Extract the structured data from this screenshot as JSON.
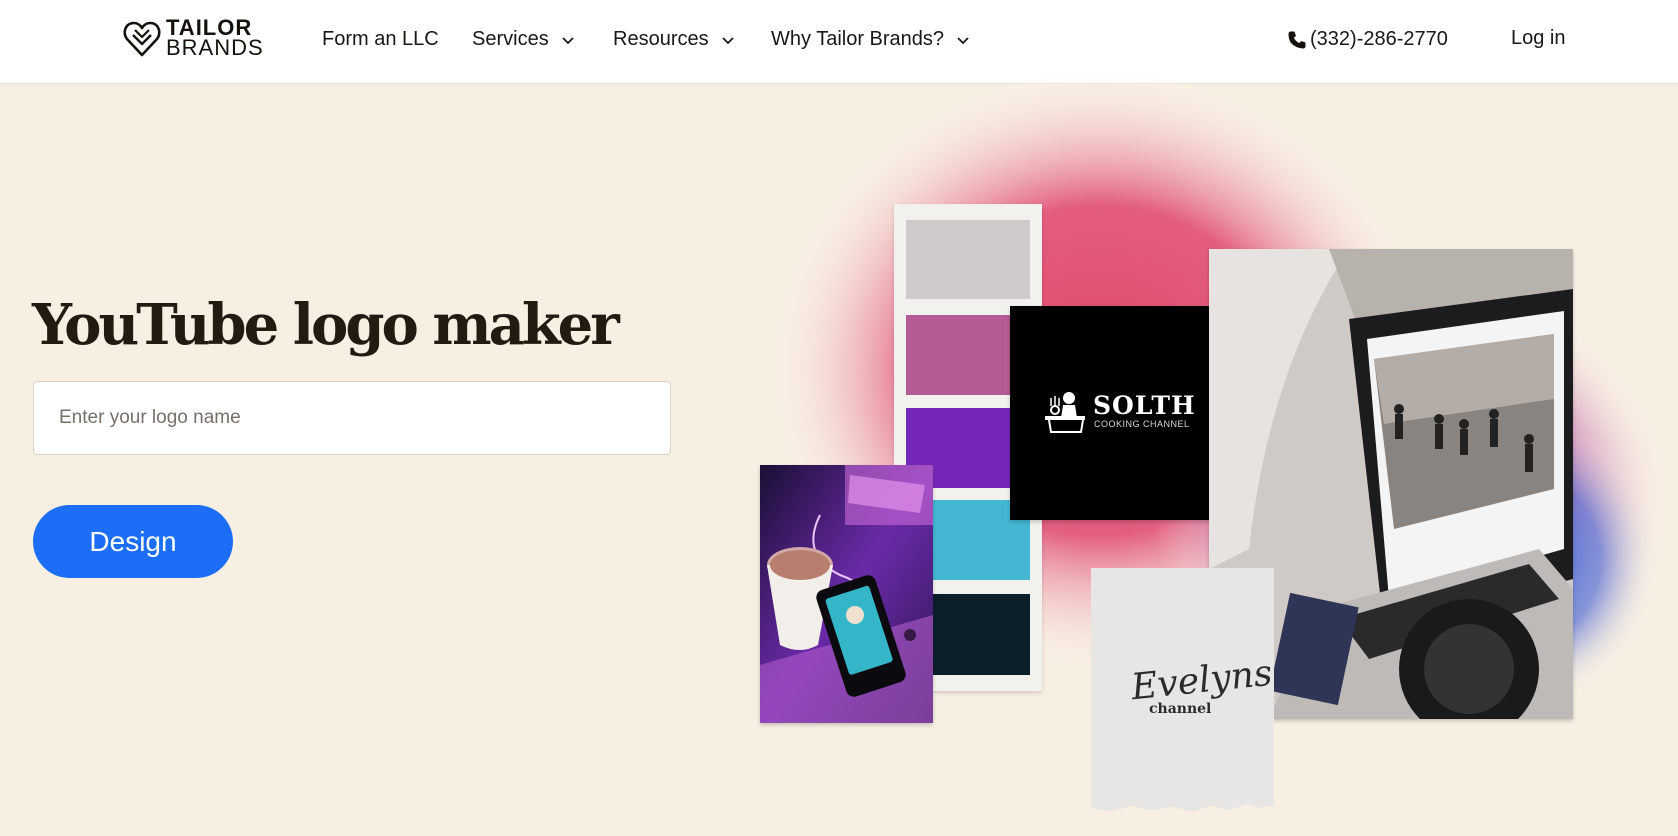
{
  "nav": {
    "logo": {
      "line1": "TAILOR",
      "line2": "BRANDS",
      "icon": "tailor-brands-heart-icon"
    },
    "items": [
      {
        "label": "Form an LLC",
        "dropdown": false
      },
      {
        "label": "Services",
        "dropdown": true
      },
      {
        "label": "Resources",
        "dropdown": true
      },
      {
        "label": "Why Tailor Brands?",
        "dropdown": true
      }
    ],
    "phone": {
      "number": "(332)-286-2770",
      "icon": "phone-icon"
    },
    "login_label": "Log in"
  },
  "hero": {
    "title": "YouTube logo maker",
    "input": {
      "placeholder": "Enter your logo name",
      "value": ""
    },
    "button_label": "Design"
  },
  "collage": {
    "palette_colors": [
      "#cfcbca",
      "#b55a93",
      "#7427b8",
      "#44b8d2",
      "#0b1f2b"
    ],
    "solth": {
      "name": "SOLTH",
      "tagline": "COOKING CHANNEL"
    },
    "evelyns": {
      "name": "Evelyns",
      "tagline": "channel"
    }
  },
  "colors": {
    "background": "#f8efe3",
    "accent": "#1b6ef5",
    "text": "#231b12"
  }
}
